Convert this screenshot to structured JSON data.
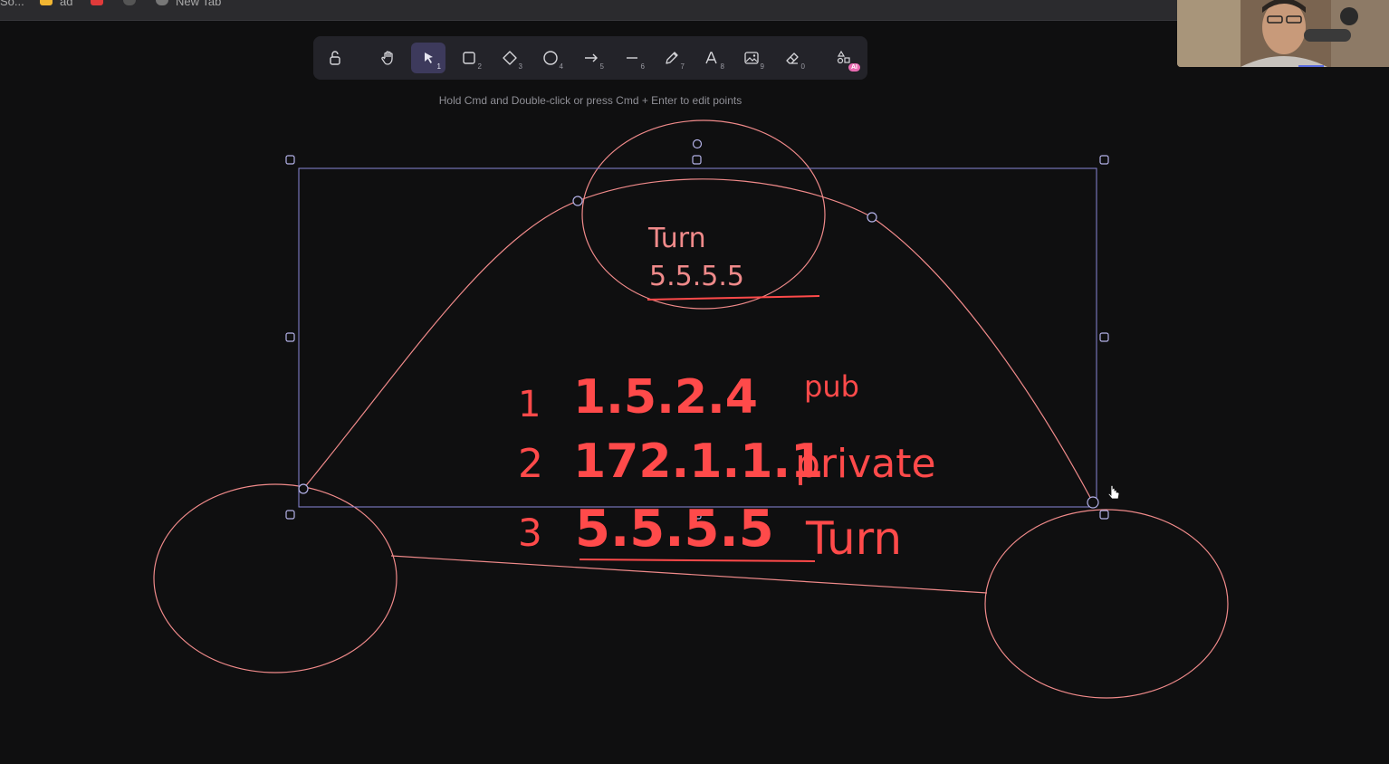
{
  "browser": {
    "tabs": [
      {
        "label": "So..."
      },
      {
        "label": "ad"
      },
      {
        "label": "New Tab"
      }
    ]
  },
  "toolbar": {
    "tools": [
      {
        "name": "lock",
        "key": ""
      },
      {
        "name": "hand",
        "key": ""
      },
      {
        "name": "selection",
        "key": "1",
        "active": true
      },
      {
        "name": "rectangle",
        "key": "2"
      },
      {
        "name": "diamond",
        "key": "3"
      },
      {
        "name": "ellipse",
        "key": "4"
      },
      {
        "name": "arrow",
        "key": "5"
      },
      {
        "name": "line",
        "key": "6"
      },
      {
        "name": "draw",
        "key": "7"
      },
      {
        "name": "text",
        "key": "8"
      },
      {
        "name": "image",
        "key": "9"
      },
      {
        "name": "eraser",
        "key": "0"
      },
      {
        "name": "more-tools",
        "badge": "AI"
      }
    ]
  },
  "hint": "Hold Cmd and Double-click or press Cmd + Enter to edit points",
  "canvas": {
    "top_label": "Turn",
    "top_ip": "5.5.5.5",
    "list": [
      {
        "num": "1",
        "ip": "1.5.2.4",
        "note": "pub"
      },
      {
        "num": "2",
        "ip": "172.1.1.1",
        "note": "private"
      },
      {
        "num": "3",
        "ip": "5.5.5.5",
        "note": "Turn"
      }
    ]
  },
  "colors": {
    "background": "#0f0f10",
    "accent": "#6965db",
    "stroke_pink": "#f08a8a",
    "handwriting_red": "#ff4a4a"
  }
}
